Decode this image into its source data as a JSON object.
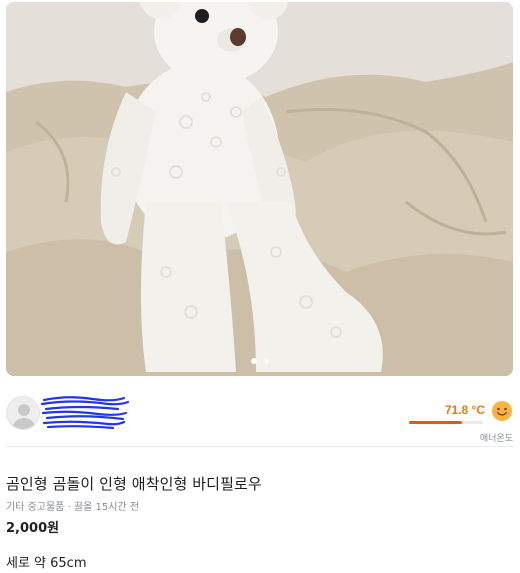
{
  "photo": {
    "alt": "white teddy bear on beige comforter",
    "pager": {
      "total": 2,
      "current": 1
    }
  },
  "seller": {
    "avatar_icon": "default-profile-icon",
    "name_redacted": true,
    "manner": {
      "temperature": "71.8 °C",
      "temperature_value": 71.8,
      "label": "매너온도",
      "face_icon": "smiling-face-icon",
      "color": "#de7c19"
    }
  },
  "item": {
    "title": "곰인형 곰돌이 인형 애착인형 바디필로우",
    "category": "기타 중고물품",
    "separator": "·",
    "bumped": "끌올 15시간 전",
    "price": "2,000원",
    "description": "세로 약 65cm"
  }
}
